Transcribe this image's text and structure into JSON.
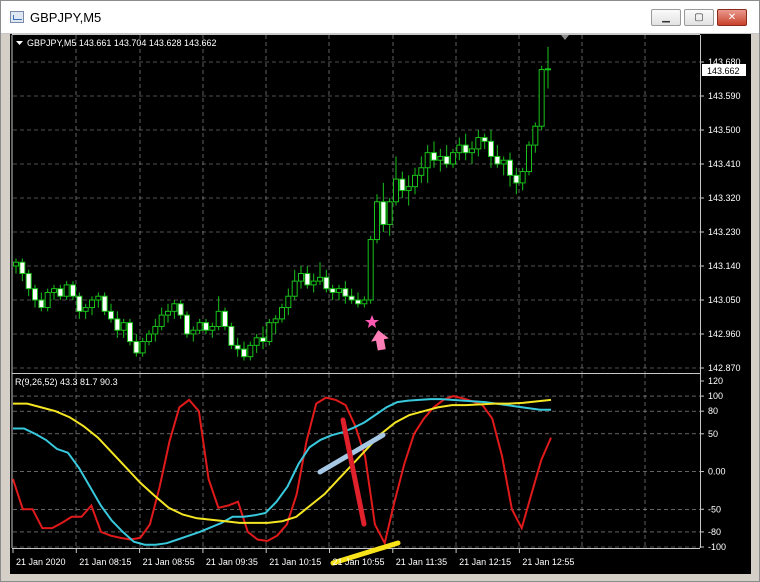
{
  "window": {
    "title": "GBPJPY,M5",
    "minimize_glyph": "▁",
    "maximize_glyph": "▢",
    "close_glyph": "✕"
  },
  "colors": {
    "background": "#000000",
    "grid": "#a0a0a0",
    "candle": "#19c21a",
    "axis_text": "#ffffff",
    "price_tag": "#ffffff",
    "red_line": "#e01a1a",
    "cyan_line": "#38c9dd",
    "yellow_line": "#f5e623",
    "drawn_blue": "#a6c8e4",
    "drawn_red": "#e0202a",
    "drawn_yellow": "#f8e21a",
    "arrow": "#ff7fb6",
    "star": "#ff59b3"
  },
  "price_panel": {
    "header_label": "GBPJPY,M5  143.661 143.704 143.628 143.662",
    "current_price": "143.662",
    "price_labels": [
      "143.680",
      "143.590",
      "143.500",
      "143.410",
      "143.320",
      "143.230",
      "143.140",
      "143.050",
      "142.960",
      "142.870"
    ],
    "signal_marker": {
      "type": "buy-arrow",
      "icon": "up-arrow-icon",
      "star_icon": "star-icon",
      "candle_index": 53
    }
  },
  "indicator_panel": {
    "header_label": "R(9,26,52) 43.3 81.7 90.3",
    "level_labels": [
      "120",
      "100",
      "80",
      "50",
      "0.00",
      "-50",
      "-80",
      "-100"
    ]
  },
  "time_labels": [
    "21 Jan 2020",
    "21 Jan 08:15",
    "21 Jan 08:55",
    "21 Jan 09:35",
    "21 Jan 10:15",
    "21 Jan 10:55",
    "21 Jan 11:35",
    "21 Jan 12:15",
    "21 Jan 12:55"
  ],
  "chart_data": {
    "type": "candlestick",
    "symbol": "GBPJPY",
    "timeframe": "M5",
    "ylim": [
      142.87,
      143.68
    ],
    "candles": [
      [
        143.14,
        143.16,
        143.12,
        143.15
      ],
      [
        143.15,
        143.16,
        143.1,
        143.12
      ],
      [
        143.12,
        143.13,
        143.06,
        143.08
      ],
      [
        143.08,
        143.09,
        143.03,
        143.05
      ],
      [
        143.05,
        143.07,
        143.02,
        143.03
      ],
      [
        143.03,
        143.08,
        143.02,
        143.07
      ],
      [
        143.07,
        143.09,
        143.05,
        143.08
      ],
      [
        143.08,
        143.09,
        143.05,
        143.06
      ],
      [
        143.06,
        143.1,
        143.05,
        143.09
      ],
      [
        143.09,
        143.1,
        143.05,
        143.06
      ],
      [
        143.06,
        143.07,
        143.0,
        143.02
      ],
      [
        143.02,
        143.04,
        143.0,
        143.03
      ],
      [
        143.03,
        143.06,
        143.01,
        143.05
      ],
      [
        143.05,
        143.07,
        143.03,
        143.06
      ],
      [
        143.06,
        143.07,
        143.01,
        143.02
      ],
      [
        143.02,
        143.04,
        142.99,
        143.0
      ],
      [
        143.0,
        143.02,
        142.95,
        142.97
      ],
      [
        142.97,
        143.0,
        142.95,
        142.99
      ],
      [
        142.99,
        143.0,
        142.93,
        142.94
      ],
      [
        142.94,
        142.96,
        142.9,
        142.91
      ],
      [
        142.91,
        142.95,
        142.9,
        142.94
      ],
      [
        142.94,
        142.97,
        142.93,
        142.96
      ],
      [
        142.96,
        143.0,
        142.94,
        142.98
      ],
      [
        142.98,
        143.03,
        142.97,
        143.01
      ],
      [
        143.01,
        143.04,
        142.99,
        143.02
      ],
      [
        143.02,
        143.05,
        143.0,
        143.04
      ],
      [
        143.04,
        143.05,
        143.0,
        143.01
      ],
      [
        143.01,
        143.02,
        142.95,
        142.96
      ],
      [
        142.96,
        142.98,
        142.94,
        142.97
      ],
      [
        142.97,
        143.0,
        142.96,
        142.99
      ],
      [
        142.99,
        143.0,
        142.96,
        142.97
      ],
      [
        142.97,
        142.99,
        142.95,
        142.98
      ],
      [
        142.98,
        143.06,
        142.97,
        143.02
      ],
      [
        143.02,
        143.03,
        142.97,
        142.98
      ],
      [
        142.98,
        142.99,
        142.92,
        142.93
      ],
      [
        142.93,
        142.95,
        142.9,
        142.92
      ],
      [
        142.92,
        142.94,
        142.89,
        142.9
      ],
      [
        142.9,
        142.94,
        142.89,
        142.93
      ],
      [
        142.93,
        142.96,
        142.91,
        142.95
      ],
      [
        142.95,
        142.98,
        142.92,
        142.94
      ],
      [
        142.94,
        143.0,
        142.93,
        142.99
      ],
      [
        142.99,
        143.01,
        142.96,
        143.0
      ],
      [
        143.0,
        143.04,
        142.99,
        143.03
      ],
      [
        143.03,
        143.08,
        143.01,
        143.06
      ],
      [
        143.06,
        143.13,
        143.05,
        143.1
      ],
      [
        143.1,
        143.14,
        143.08,
        143.12
      ],
      [
        143.12,
        143.14,
        143.08,
        143.09
      ],
      [
        143.09,
        143.12,
        143.07,
        143.1
      ],
      [
        143.1,
        143.15,
        143.09,
        143.11
      ],
      [
        143.11,
        143.13,
        143.07,
        143.08
      ],
      [
        143.08,
        143.09,
        143.05,
        143.07
      ],
      [
        143.07,
        143.09,
        143.05,
        143.08
      ],
      [
        143.08,
        143.1,
        143.04,
        143.06
      ],
      [
        143.06,
        143.08,
        143.04,
        143.05
      ],
      [
        143.05,
        143.07,
        143.03,
        143.04
      ],
      [
        143.04,
        143.06,
        143.03,
        143.05
      ],
      [
        143.05,
        143.22,
        143.04,
        143.21
      ],
      [
        143.21,
        143.33,
        143.2,
        143.31
      ],
      [
        143.31,
        143.36,
        143.23,
        143.25
      ],
      [
        143.25,
        143.32,
        143.22,
        143.31
      ],
      [
        143.31,
        143.43,
        143.3,
        143.37
      ],
      [
        143.37,
        143.39,
        143.32,
        143.34
      ],
      [
        143.34,
        143.38,
        143.3,
        143.35
      ],
      [
        143.35,
        143.4,
        143.33,
        143.38
      ],
      [
        143.38,
        143.43,
        143.36,
        143.4
      ],
      [
        143.4,
        143.46,
        143.36,
        143.44
      ],
      [
        143.44,
        143.47,
        143.4,
        143.42
      ],
      [
        143.42,
        143.45,
        143.39,
        143.43
      ],
      [
        143.43,
        143.46,
        143.4,
        143.41
      ],
      [
        143.41,
        143.45,
        143.4,
        143.44
      ],
      [
        143.44,
        143.48,
        143.42,
        143.46
      ],
      [
        143.46,
        143.49,
        143.42,
        143.44
      ],
      [
        143.44,
        143.47,
        143.41,
        143.45
      ],
      [
        143.45,
        143.5,
        143.43,
        143.48
      ],
      [
        143.48,
        143.49,
        143.45,
        143.47
      ],
      [
        143.47,
        143.5,
        143.4,
        143.43
      ],
      [
        143.43,
        143.46,
        143.4,
        143.41
      ],
      [
        143.41,
        143.43,
        143.38,
        143.42
      ],
      [
        143.42,
        143.44,
        143.35,
        143.38
      ],
      [
        143.38,
        143.4,
        143.33,
        143.36
      ],
      [
        143.36,
        143.4,
        143.34,
        143.39
      ],
      [
        143.39,
        143.47,
        143.38,
        143.46
      ],
      [
        143.46,
        143.52,
        143.44,
        143.51
      ],
      [
        143.51,
        143.67,
        143.5,
        143.66
      ],
      [
        143.66,
        143.72,
        143.61,
        143.662
      ]
    ],
    "indicator": {
      "name": "R(9,26,52)",
      "ylim": [
        -100,
        120
      ],
      "levels": [
        100,
        80,
        50,
        0,
        -50,
        -80,
        -100
      ],
      "series": [
        {
          "name": "9",
          "values": [
            -10,
            -50,
            -50,
            -75,
            -75,
            -68,
            -60,
            -60,
            -45,
            -80,
            -85,
            -88,
            -90,
            -88,
            -70,
            -20,
            40,
            85,
            95,
            80,
            -10,
            -48,
            -45,
            -40,
            -80,
            -90,
            -92,
            -85,
            -70,
            -30,
            40,
            90,
            98,
            95,
            88,
            60,
            20,
            -70,
            -95,
            -40,
            10,
            50,
            70,
            85,
            95,
            100,
            97,
            93,
            88,
            70,
            20,
            -50,
            -75,
            -30,
            15,
            45
          ],
          "color": "#e01a1a"
        },
        {
          "name": "26",
          "values": [
            57,
            57,
            50,
            42,
            30,
            25,
            5,
            -20,
            -45,
            -65,
            -80,
            -93,
            -97,
            -97,
            -95,
            -90,
            -85,
            -80,
            -74,
            -68,
            -60,
            -60,
            -58,
            -55,
            -40,
            -20,
            10,
            32,
            42,
            48,
            52,
            58,
            65,
            75,
            85,
            92,
            94,
            95,
            96,
            96,
            95,
            94,
            93,
            92,
            90,
            88,
            86,
            84,
            82,
            82
          ],
          "color": "#38c9dd"
        },
        {
          "name": "52",
          "values": [
            90,
            90,
            85,
            80,
            72,
            60,
            45,
            25,
            5,
            -15,
            -32,
            -48,
            -57,
            -62,
            -64,
            -66,
            -68,
            -68,
            -68,
            -66,
            -60,
            -45,
            -30,
            -10,
            10,
            30,
            50,
            65,
            75,
            80,
            85,
            88,
            88,
            89,
            90,
            90,
            91,
            93,
            95
          ],
          "color": "#f5e623"
        }
      ]
    }
  }
}
